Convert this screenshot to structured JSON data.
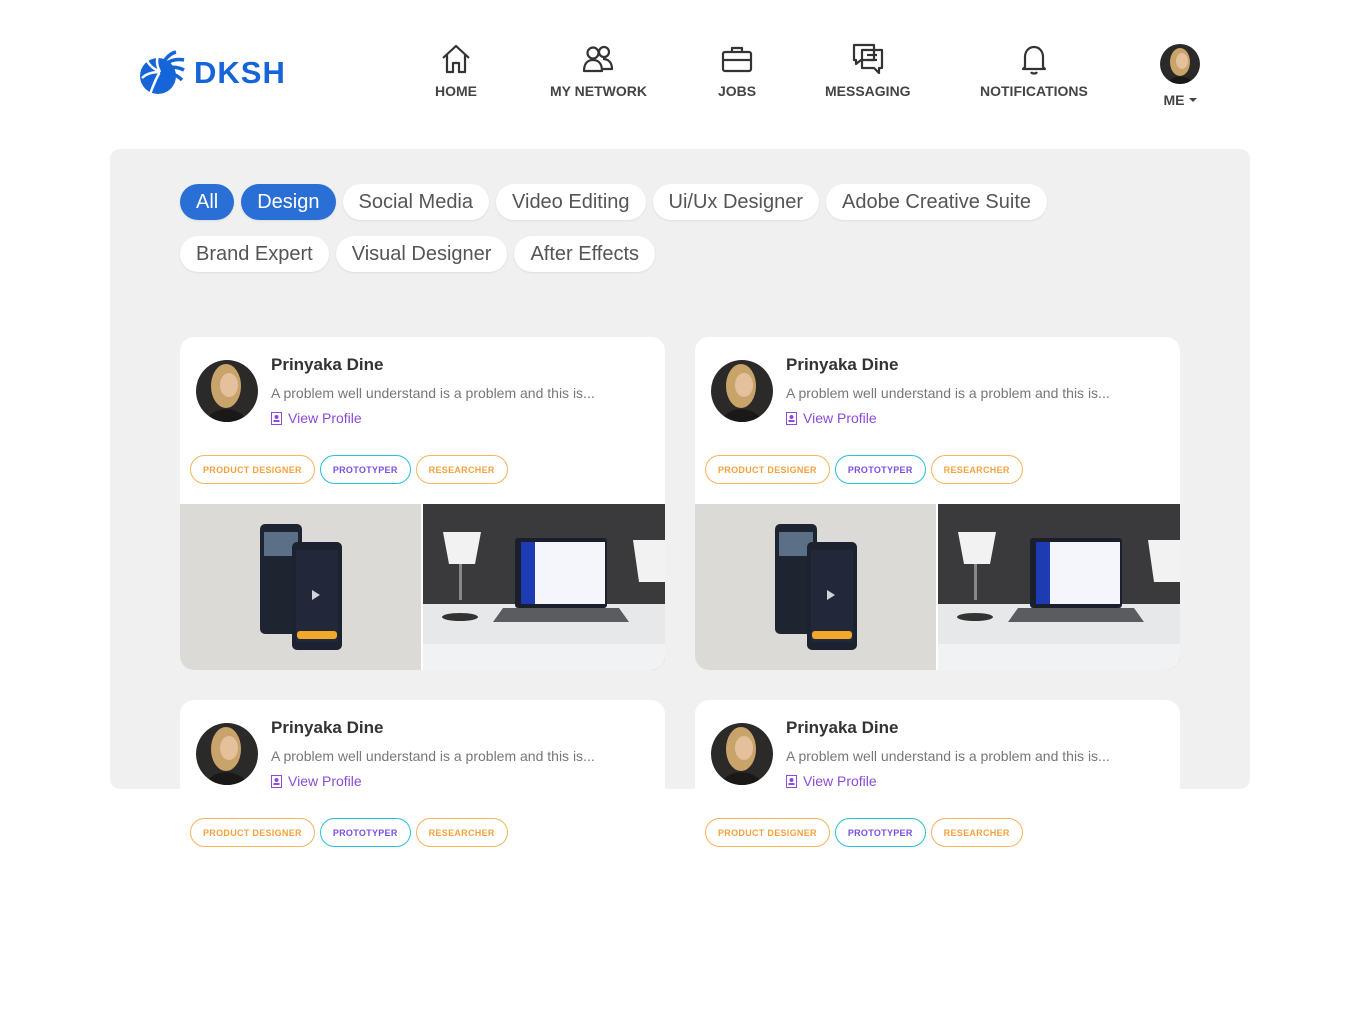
{
  "brand": {
    "name": "DKSH",
    "color": "#1565d8"
  },
  "nav": {
    "home": {
      "label": "HOME",
      "icon": "home-icon"
    },
    "network": {
      "label": "MY NETWORK",
      "icon": "network-icon"
    },
    "jobs": {
      "label": "JOBS",
      "icon": "briefcase-icon"
    },
    "messaging": {
      "label": "MESSAGING",
      "icon": "chat-icon"
    },
    "notifications": {
      "label": "NOTIFICATIONS",
      "icon": "bell-icon"
    },
    "me": {
      "label": "ME",
      "icon": "chevron-down-icon"
    }
  },
  "filters": {
    "chips": [
      "All",
      "Design",
      "Social Media",
      "Video Editing",
      "Ui/Ux Designer",
      "Adobe Creative Suite",
      "Brand Expert",
      "Visual Designer",
      "After Effects"
    ],
    "active": [
      "All",
      "Design"
    ],
    "accent": "#2a6fd6"
  },
  "cards": [
    {
      "name": "Prinyaka Dine",
      "description": "A problem well understand is a problem and this is...",
      "link": "View Profile",
      "tags": [
        "PRODUCT DESIGNER",
        "PROTOTYPER",
        "RESEARCHER"
      ]
    },
    {
      "name": "Prinyaka Dine",
      "description": "A problem well understand is a problem and this is...",
      "link": "View Profile",
      "tags": [
        "PRODUCT DESIGNER",
        "PROTOTYPER",
        "RESEARCHER"
      ]
    },
    {
      "name": "Prinyaka Dine",
      "description": "A problem well understand is a problem and this is...",
      "link": "View Profile",
      "tags": [
        "PRODUCT DESIGNER",
        "PROTOTYPER",
        "RESEARCHER"
      ]
    },
    {
      "name": "Prinyaka Dine",
      "description": "A problem well understand is a problem and this is...",
      "link": "View Profile",
      "tags": [
        "PRODUCT DESIGNER",
        "PROTOTYPER",
        "RESEARCHER"
      ]
    }
  ]
}
